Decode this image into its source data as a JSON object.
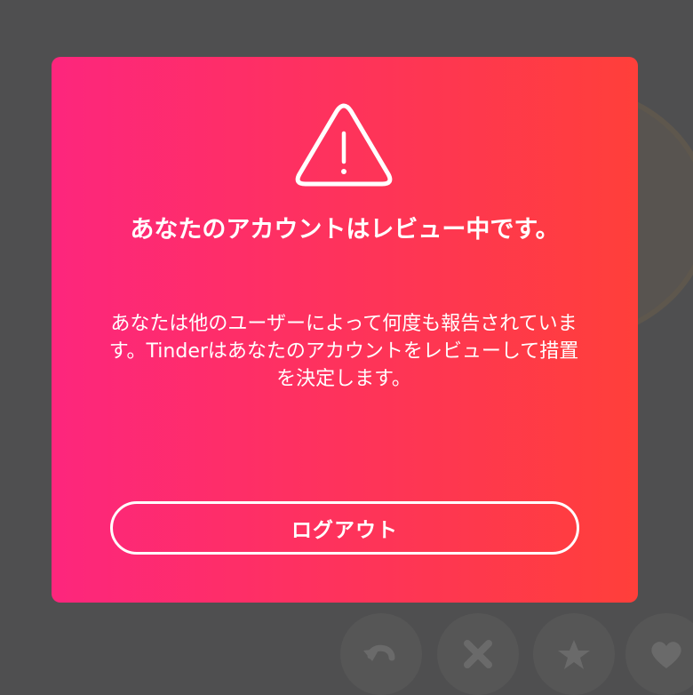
{
  "modal": {
    "icon": "warning-triangle-icon",
    "title": "あなたのアカウントはレビュー中です。",
    "message": "あなたは他のユーザーによって何度も報告されています。Tinderはあなたのアカウントをレビューして措置を決定します。",
    "logout_label": "ログアウト"
  },
  "background_actions": [
    {
      "icon": "rewind-icon"
    },
    {
      "icon": "close-icon"
    },
    {
      "icon": "star-icon"
    },
    {
      "icon": "heart-icon"
    }
  ],
  "colors": {
    "overlay": "#4f4f50",
    "gradient_start": "#fd267d",
    "gradient_end": "#ff3f3a",
    "text": "#ffffff"
  }
}
